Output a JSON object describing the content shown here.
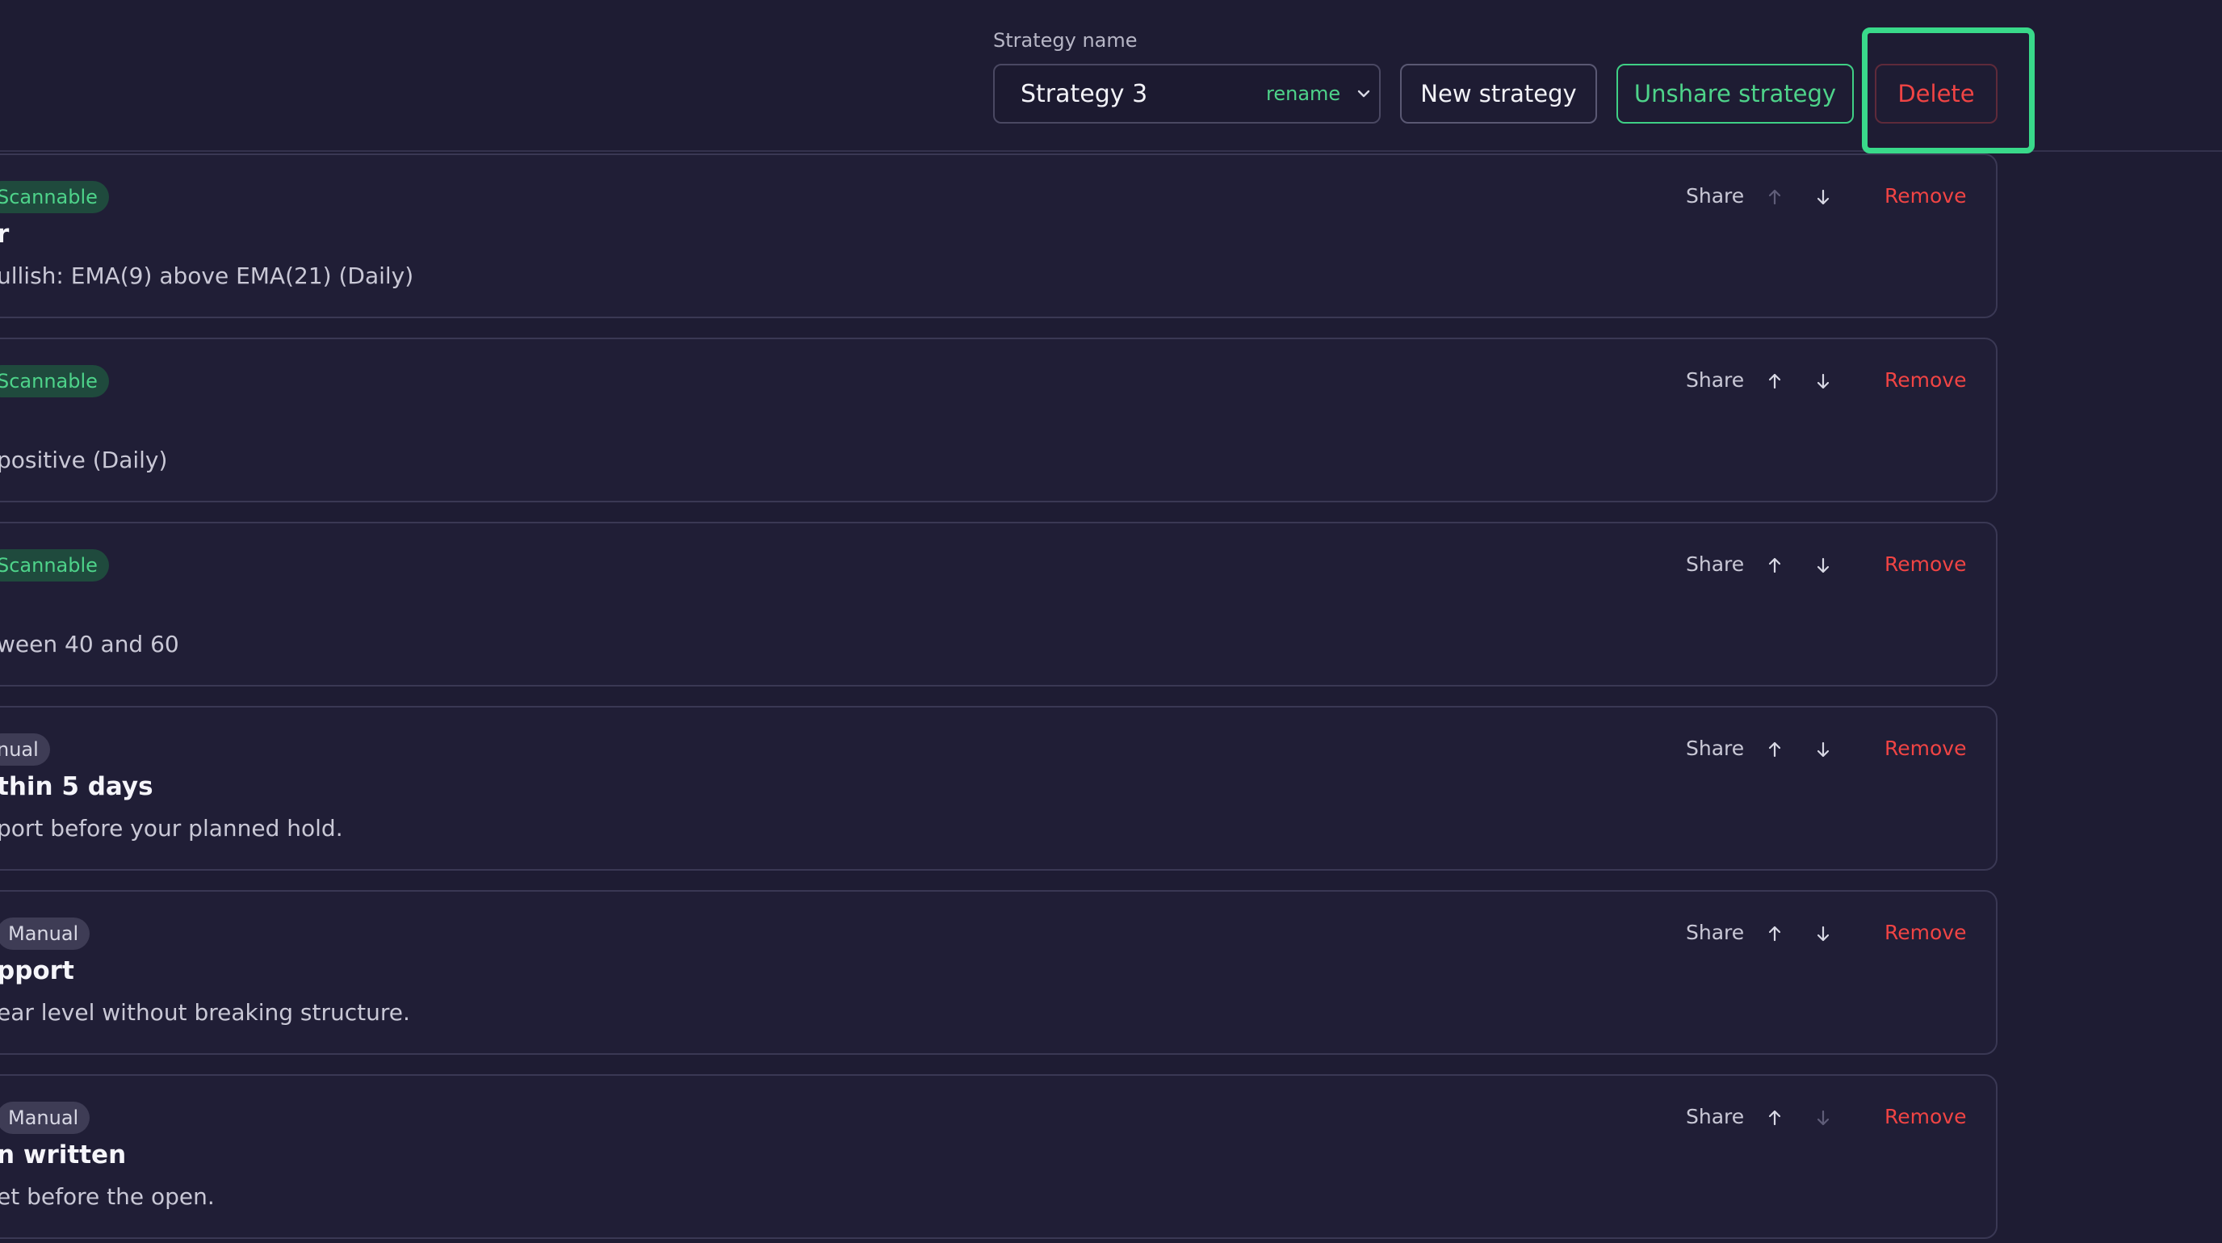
{
  "header": {
    "strategy_label": "Strategy name",
    "strategy_value": "Strategy 3",
    "rename_label": "rename",
    "new_strategy_label": "New strategy",
    "unshare_label": "Unshare strategy",
    "delete_label": "Delete"
  },
  "colors": {
    "background": "#1e1c33",
    "accent_green": "#4ed38a",
    "danger_red": "#f04444"
  },
  "cards": [
    {
      "badge": "Scannable",
      "title": "r",
      "description": "ullish: EMA(9) above EMA(21) (Daily)",
      "share": "Share",
      "remove": "Remove",
      "up_enabled": false,
      "down_enabled": true
    },
    {
      "badge": "Scannable",
      "title": "",
      "description": "positive (Daily)",
      "share": "Share",
      "remove": "Remove",
      "up_enabled": true,
      "down_enabled": true
    },
    {
      "badge": "Scannable",
      "title": "",
      "description": "ween 40 and 60",
      "share": "Share",
      "remove": "Remove",
      "up_enabled": true,
      "down_enabled": true
    },
    {
      "badge": "nual",
      "title": "thin 5 days",
      "description": "port before your planned hold.",
      "share": "Share",
      "remove": "Remove",
      "up_enabled": true,
      "down_enabled": true
    },
    {
      "badge": "Manual",
      "title": "pport",
      "description": "ear level without breaking structure.",
      "share": "Share",
      "remove": "Remove",
      "up_enabled": true,
      "down_enabled": true
    },
    {
      "badge": "Manual",
      "title": "n written",
      "description": "et before the open.",
      "share": "Share",
      "remove": "Remove",
      "up_enabled": true,
      "down_enabled": false
    }
  ]
}
